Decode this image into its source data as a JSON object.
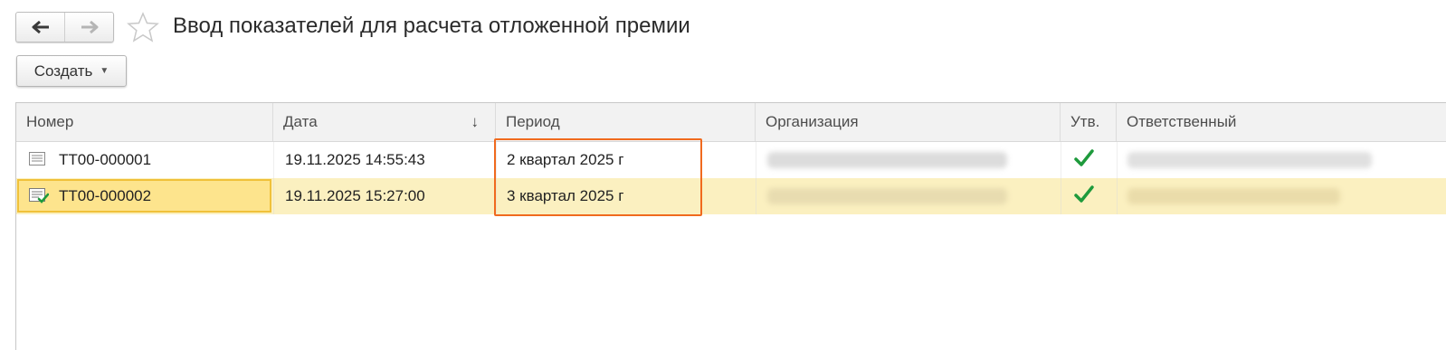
{
  "window": {
    "title": "Ввод показателей для расчета отложенной премии"
  },
  "toolbar": {
    "create_label": "Создать"
  },
  "table": {
    "columns": [
      "Номер",
      "Дата",
      "Период",
      "Организация",
      "Утв.",
      "Ответственный"
    ],
    "sort_indicator": "↓",
    "rows": [
      {
        "number": "ТТ00-000001",
        "date": "19.11.2025 14:55:43",
        "period": "2 квартал 2025 г",
        "approved": true,
        "selected": false
      },
      {
        "number": "ТТ00-000002",
        "date": "19.11.2025 15:27:00",
        "period": "3 квартал 2025 г",
        "approved": true,
        "selected": true
      }
    ]
  },
  "colors": {
    "selected_row": "#fbf0c0",
    "selected_cell": "#fde48d",
    "highlight_frame": "#f06a1e",
    "check": "#1e9a3c"
  },
  "icons": [
    "back-arrow-icon",
    "forward-arrow-icon",
    "favorite-star-icon",
    "document-icon",
    "document-posted-icon",
    "checkmark-icon",
    "dropdown-caret-icon"
  ]
}
